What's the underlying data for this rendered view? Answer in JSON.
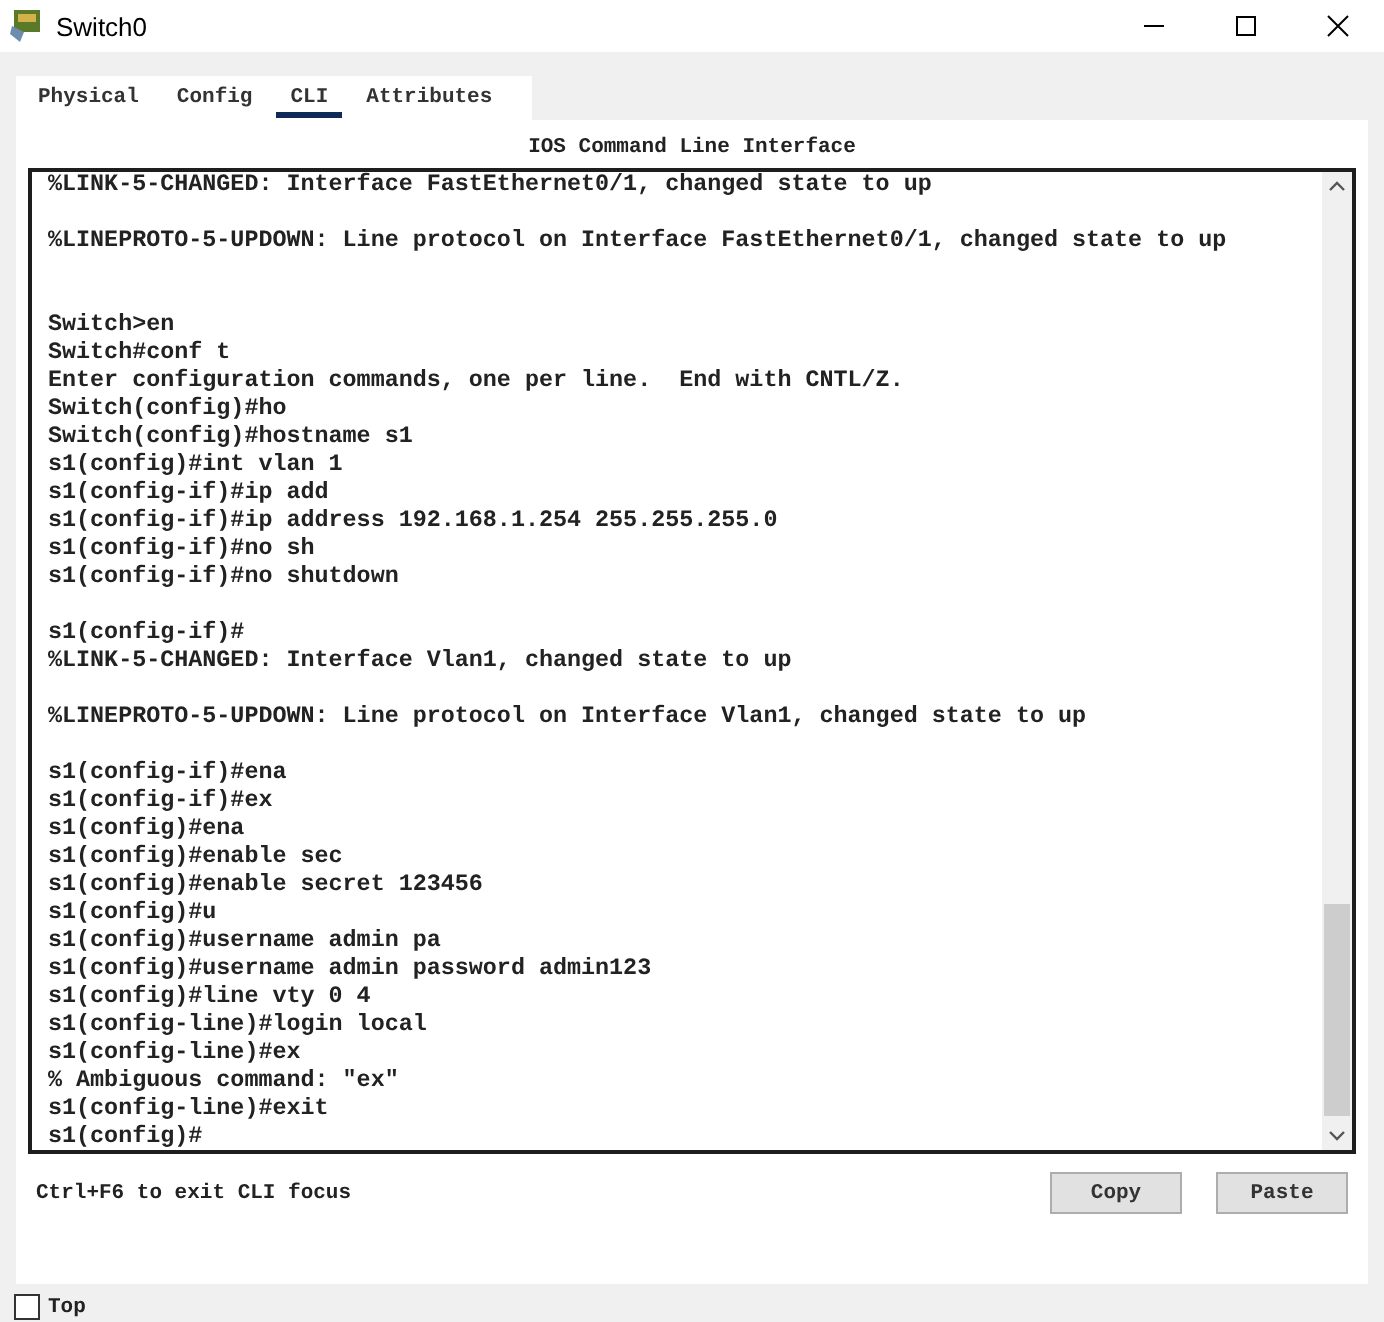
{
  "window": {
    "title": "Switch0"
  },
  "tabs": [
    {
      "label": "Physical",
      "selected": false
    },
    {
      "label": "Config",
      "selected": false
    },
    {
      "label": "CLI",
      "selected": true
    },
    {
      "label": "Attributes",
      "selected": false
    }
  ],
  "heading": "IOS Command Line Interface",
  "terminal": {
    "lines": [
      {
        "kind": "text",
        "text": "%LINK-5-CHANGED: Interface FastEthernet0/1, changed state to up"
      },
      {
        "kind": "blank"
      },
      {
        "kind": "text",
        "text": "%LINEPROTO-5-UPDOWN: Line protocol on Interface FastEthernet0/1, changed state to up"
      },
      {
        "kind": "blank"
      },
      {
        "kind": "blank"
      },
      {
        "kind": "text",
        "text": "Switch>en"
      },
      {
        "kind": "text",
        "text": "Switch#conf t"
      },
      {
        "kind": "text",
        "text": "Enter configuration commands, one per line.  End with CNTL/Z."
      },
      {
        "kind": "text",
        "text": "Switch(config)#ho"
      },
      {
        "kind": "text",
        "text": "Switch(config)#hostname s1"
      },
      {
        "kind": "text",
        "text": "s1(config)#int vlan 1"
      },
      {
        "kind": "text",
        "text": "s1(config-if)#ip add"
      },
      {
        "kind": "text",
        "text": "s1(config-if)#ip address 192.168.1.254 255.255.255.0"
      },
      {
        "kind": "text",
        "text": "s1(config-if)#no sh"
      },
      {
        "kind": "text",
        "text": "s1(config-if)#no shutdown"
      },
      {
        "kind": "blank"
      },
      {
        "kind": "text",
        "text": "s1(config-if)#"
      },
      {
        "kind": "text",
        "text": "%LINK-5-CHANGED: Interface Vlan1, changed state to up"
      },
      {
        "kind": "blank"
      },
      {
        "kind": "text",
        "text": "%LINEPROTO-5-UPDOWN: Line protocol on Interface Vlan1, changed state to up"
      },
      {
        "kind": "blank"
      },
      {
        "kind": "text",
        "text": "s1(config-if)#ena"
      },
      {
        "kind": "text",
        "text": "s1(config-if)#ex"
      },
      {
        "kind": "text",
        "text": "s1(config)#ena"
      },
      {
        "kind": "text",
        "text": "s1(config)#enable sec"
      },
      {
        "kind": "text",
        "text": "s1(config)#enable secret 123456"
      },
      {
        "kind": "text",
        "text": "s1(config)#u"
      },
      {
        "kind": "text",
        "text": "s1(config)#username admin pa"
      },
      {
        "kind": "text",
        "text": "s1(config)#username admin password admin123"
      },
      {
        "kind": "text",
        "text": "s1(config)#line vty 0 4"
      },
      {
        "kind": "text",
        "text": "s1(config-line)#login local"
      },
      {
        "kind": "text",
        "text": "s1(config-line)#ex"
      },
      {
        "kind": "text",
        "text": "% Ambiguous command: \"ex\""
      },
      {
        "kind": "text",
        "text": "s1(config-line)#exit"
      },
      {
        "kind": "text",
        "text": "s1(config)#"
      }
    ]
  },
  "hint": "Ctrl+F6 to exit CLI focus",
  "buttons": [
    "Copy",
    "Paste"
  ],
  "top_checkbox": {
    "label": "Top",
    "checked": false
  }
}
